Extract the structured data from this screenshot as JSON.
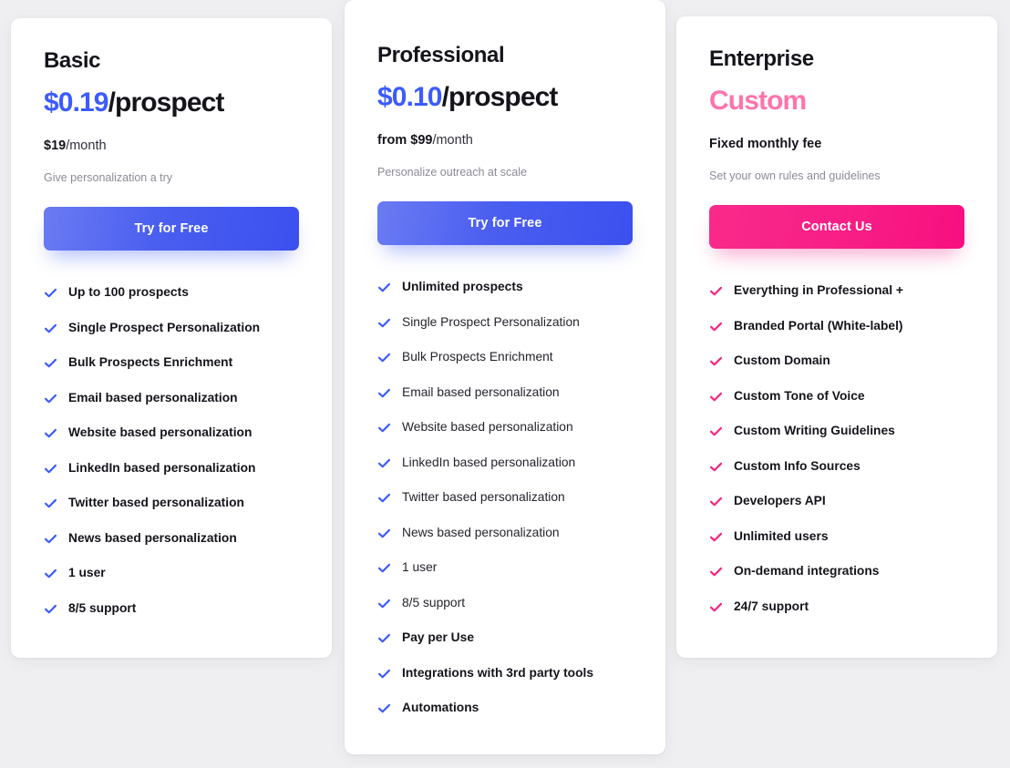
{
  "theme": {
    "page_background": "#efeff1",
    "card_background": "#ffffff",
    "accent_blue": "#3b5bfd",
    "accent_pink": "#f8227f",
    "custom_pink_text": "#fd74ad",
    "text_dark": "#14141b",
    "text_muted": "#8b8b97"
  },
  "plans": [
    {
      "id": "basic",
      "title": "Basic",
      "price_amount": "$0.19",
      "price_unit": "/prospect",
      "billing_prefix": "",
      "billing_amount": "$19",
      "billing_period": "/month",
      "tagline": "Give personalization a try",
      "cta_label": "Try for Free",
      "cta_style": "blue",
      "check_color": "#3b5bfd",
      "features": [
        {
          "label": "Up to 100 prospects",
          "bold": true
        },
        {
          "label": "Single Prospect Personalization",
          "bold": true
        },
        {
          "label": "Bulk Prospects Enrichment",
          "bold": true
        },
        {
          "label": "Email based personalization",
          "bold": true
        },
        {
          "label": "Website based personalization",
          "bold": true
        },
        {
          "label": "LinkedIn based personalization",
          "bold": true
        },
        {
          "label": "Twitter based personalization",
          "bold": true
        },
        {
          "label": "News based personalization",
          "bold": true
        },
        {
          "label": "1 user",
          "bold": true
        },
        {
          "label": "8/5 support",
          "bold": true
        }
      ]
    },
    {
      "id": "professional",
      "title": "Professional",
      "price_amount": "$0.10",
      "price_unit": "/prospect",
      "billing_prefix": "from ",
      "billing_amount": "$99",
      "billing_period": "/month",
      "tagline": "Personalize outreach at scale",
      "cta_label": "Try for Free",
      "cta_style": "blue",
      "check_color": "#3b5bfd",
      "features": [
        {
          "label": "Unlimited prospects",
          "bold": true
        },
        {
          "label": "Single Prospect Personalization",
          "bold": false
        },
        {
          "label": "Bulk Prospects Enrichment",
          "bold": false
        },
        {
          "label": "Email based personalization",
          "bold": false
        },
        {
          "label": "Website based personalization",
          "bold": false
        },
        {
          "label": "LinkedIn based personalization",
          "bold": false
        },
        {
          "label": "Twitter based personalization",
          "bold": false
        },
        {
          "label": "News based personalization",
          "bold": false
        },
        {
          "label": "1 user",
          "bold": false
        },
        {
          "label": "8/5 support",
          "bold": false
        },
        {
          "label": "Pay per Use",
          "bold": true
        },
        {
          "label": "Integrations with 3rd party tools",
          "bold": true
        },
        {
          "label": "Automations",
          "bold": true
        }
      ]
    },
    {
      "id": "enterprise",
      "title": "Enterprise",
      "price_amount": "Custom",
      "price_unit": "",
      "billing_prefix": "",
      "billing_amount": "Fixed monthly fee",
      "billing_period": "",
      "tagline": "Set your own rules and guidelines",
      "cta_label": "Contact Us",
      "cta_style": "pink",
      "check_color": "#f8227f",
      "features": [
        {
          "label": "Everything in Professional +",
          "bold": true
        },
        {
          "label": "Branded Portal (White-label)",
          "bold": true
        },
        {
          "label": "Custom Domain",
          "bold": true
        },
        {
          "label": "Custom Tone of Voice",
          "bold": true
        },
        {
          "label": "Custom Writing Guidelines",
          "bold": true
        },
        {
          "label": "Custom Info Sources",
          "bold": true
        },
        {
          "label": "Developers API",
          "bold": true
        },
        {
          "label": "Unlimited users",
          "bold": true
        },
        {
          "label": "On-demand integrations",
          "bold": true
        },
        {
          "label": "24/7 support",
          "bold": true
        }
      ]
    }
  ],
  "icons": {
    "check": "check-icon"
  }
}
